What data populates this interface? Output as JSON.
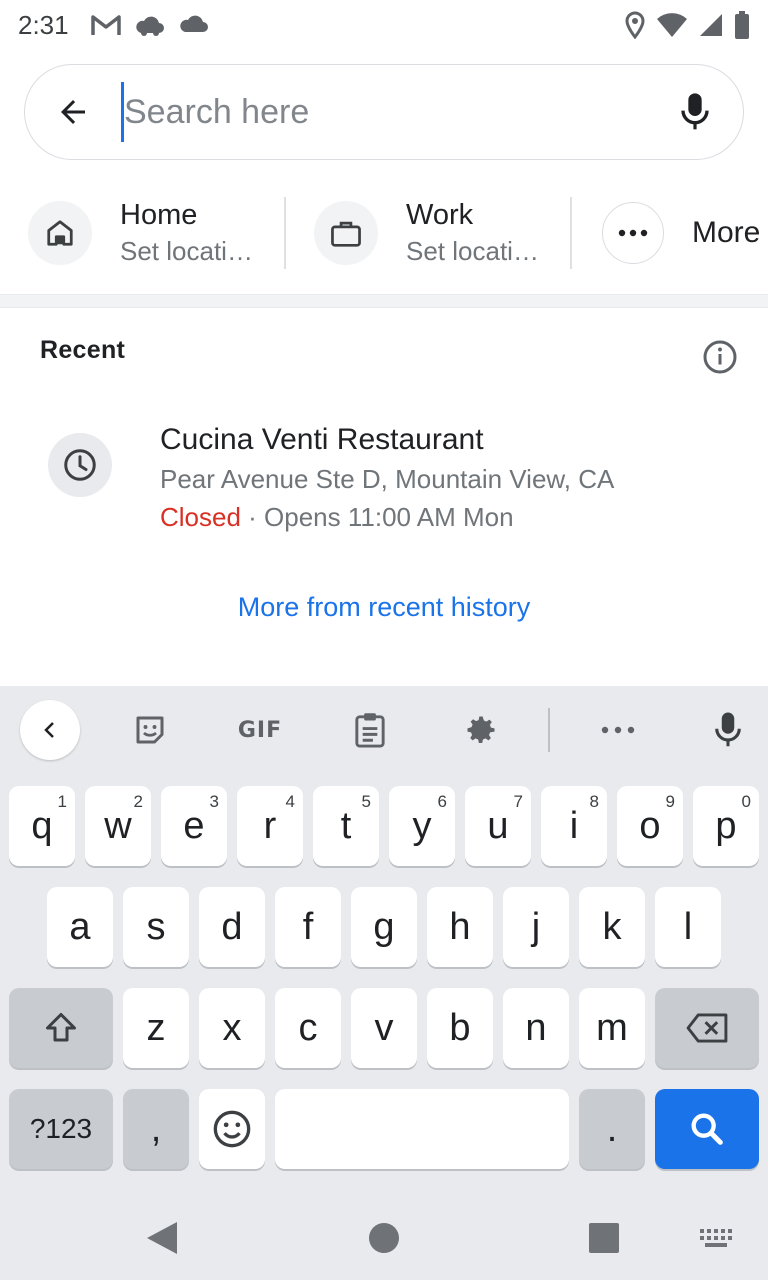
{
  "status_bar": {
    "time": "2:31",
    "icons_left": [
      "gmail-icon",
      "cloud-icon",
      "cloud-icon"
    ],
    "icons_right": [
      "location-icon",
      "wifi-icon",
      "signal-icon",
      "battery-icon"
    ]
  },
  "search": {
    "placeholder": "Search here",
    "value": ""
  },
  "shortcuts": [
    {
      "title": "Home",
      "subtitle": "Set locati…",
      "icon": "home-icon"
    },
    {
      "title": "Work",
      "subtitle": "Set locati…",
      "icon": "briefcase-icon"
    },
    {
      "title": "More",
      "subtitle": "",
      "icon": "more-horiz-icon"
    }
  ],
  "recent": {
    "header": "Recent",
    "items": [
      {
        "name": "Cucina Venti Restaurant",
        "address": "Pear Avenue Ste D, Mountain View, CA",
        "status": "Closed",
        "hours": " · Opens 11:00 AM Mon",
        "icon": "clock-icon"
      }
    ],
    "more_link": "More from recent history"
  },
  "keyboard": {
    "toolbar": {
      "gif_label": "GIF"
    },
    "row1": [
      {
        "key": "q",
        "hint": "1"
      },
      {
        "key": "w",
        "hint": "2"
      },
      {
        "key": "e",
        "hint": "3"
      },
      {
        "key": "r",
        "hint": "4"
      },
      {
        "key": "t",
        "hint": "5"
      },
      {
        "key": "y",
        "hint": "6"
      },
      {
        "key": "u",
        "hint": "7"
      },
      {
        "key": "i",
        "hint": "8"
      },
      {
        "key": "o",
        "hint": "9"
      },
      {
        "key": "p",
        "hint": "0"
      }
    ],
    "row2": [
      "a",
      "s",
      "d",
      "f",
      "g",
      "h",
      "j",
      "k",
      "l"
    ],
    "row3": [
      "z",
      "x",
      "c",
      "v",
      "b",
      "n",
      "m"
    ],
    "row4": {
      "symbols": "?123",
      "comma": ",",
      "period": "."
    }
  },
  "colors": {
    "accent": "#1a73e8",
    "closed": "#d93025",
    "keyboard_bg": "#e8eaed"
  }
}
